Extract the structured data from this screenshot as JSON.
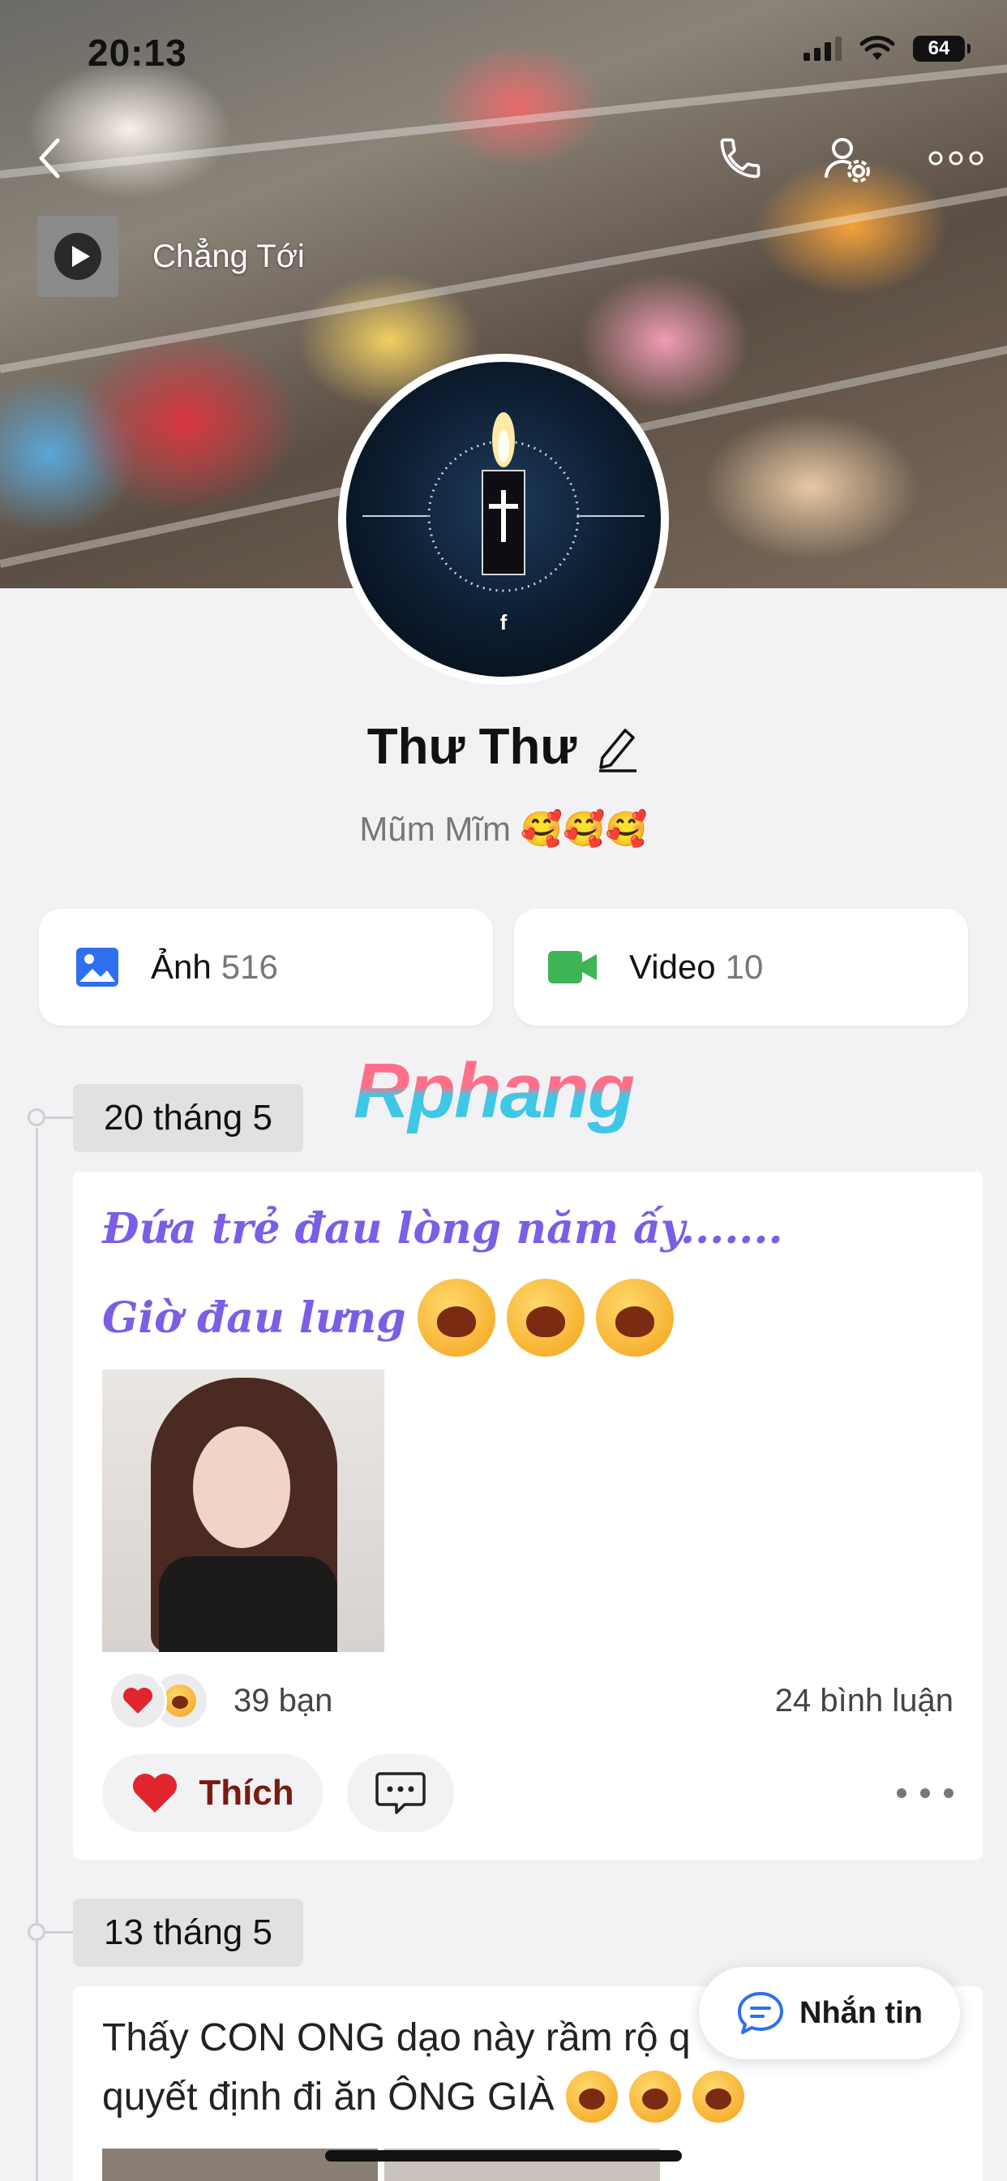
{
  "status_bar": {
    "time": "20:13",
    "battery": "64"
  },
  "header": {
    "music_label": "Chẳng Tới"
  },
  "profile": {
    "name": "Thư Thư",
    "bio": "Mũm Mĩm 🥰🥰🥰"
  },
  "media": {
    "photos_label": "Ảnh",
    "photos_count": "516",
    "videos_label": "Video",
    "videos_count": "10"
  },
  "watermark": "Rphang",
  "posts": [
    {
      "date": "20 tháng 5",
      "line1": "Đứa trẻ đau lòng năm ấy.......",
      "line2": "Giờ đau lưng",
      "reactions_text": "39 bạn",
      "comments_text": "24 bình luận",
      "like_label": "Thích"
    },
    {
      "date": "13 tháng 5",
      "line1": "Thấy CON ONG dạo này rầm rộ q",
      "line2": "quyết định đi ăn ÔNG GIÀ"
    }
  ],
  "fab": {
    "label": "Nhắn tin"
  },
  "colors": {
    "accent_purple": "#7b5de6",
    "like_red": "#e0252f",
    "photo_blue": "#2f6ff0",
    "video_green": "#3fb454"
  }
}
